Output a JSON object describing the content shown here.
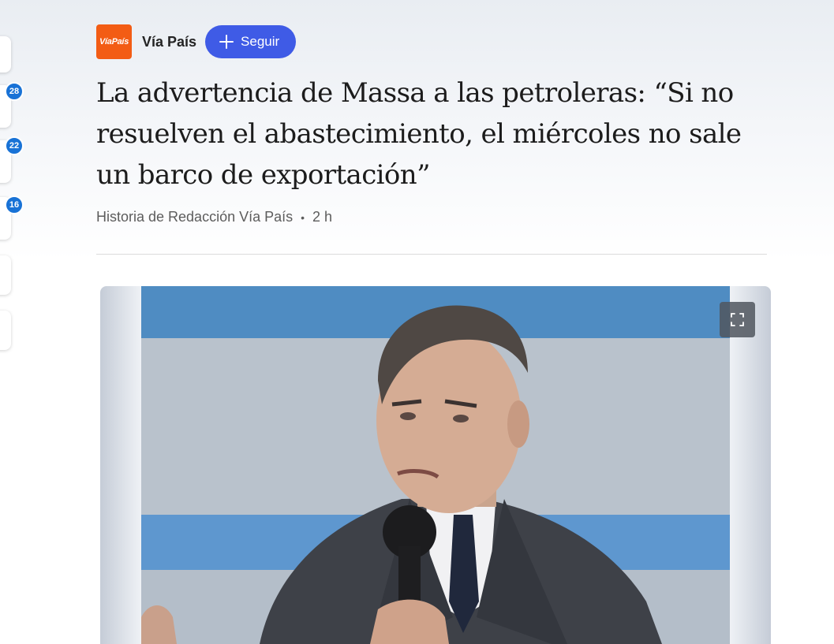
{
  "source": {
    "logo_text": "VíaPaís",
    "name": "Vía País",
    "follow_label": "Seguir"
  },
  "article": {
    "title": "La advertencia de Massa a las petroleras: “Si no resuelven el abastecimiento, el miércoles no sale un barco de exportación”",
    "byline": "Historia de Redacción Vía País",
    "time": "2 h"
  },
  "rail": {
    "badges": [
      "28",
      "22",
      "16"
    ]
  },
  "colors": {
    "accent": "#3f5be6",
    "logo": "#f35c14",
    "badge": "#1872d6"
  },
  "icons": {
    "follow": "plus-icon",
    "expand": "expand-icon"
  }
}
